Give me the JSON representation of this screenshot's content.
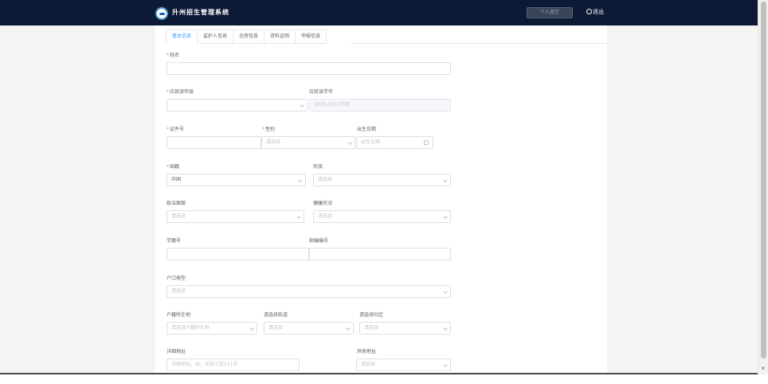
{
  "header": {
    "title": "升州招生管理系统",
    "profile_label": "个人真空",
    "logout_label": "退出"
  },
  "tabs": [
    "基本信息",
    "监护人信息",
    "住房信息",
    "资料证明",
    "申报信息"
  ],
  "form": {
    "name": {
      "label": "姓名",
      "value": ""
    },
    "grade": {
      "label": "应就读年级",
      "placeholder": ""
    },
    "school_year": {
      "label": "应就读学年",
      "value": "2020-2021学年"
    },
    "id_no": {
      "label": "证件号",
      "value": ""
    },
    "gender": {
      "label": "性别",
      "placeholder": "请选择"
    },
    "birth_date": {
      "label": "出生日期",
      "placeholder": "出生日期"
    },
    "nationality": {
      "label": "国籍",
      "value": "中国"
    },
    "ethnicity": {
      "label": "民族",
      "placeholder": "请选择"
    },
    "political": {
      "label": "政治面貌",
      "placeholder": "请选择"
    },
    "health": {
      "label": "健康状况",
      "placeholder": "请选择"
    },
    "student_no": {
      "label": "学籍号",
      "value": ""
    },
    "postal_code": {
      "label": "邮编编号",
      "value": ""
    },
    "hukou_type": {
      "label": "户口类型",
      "placeholder": "请选择"
    },
    "hukou_location": {
      "label": "户籍所在地",
      "placeholder": "请选择户籍所在地"
    },
    "street": {
      "label": "请选择街道",
      "placeholder": "请选择"
    },
    "community": {
      "label": "请选择社区",
      "placeholder": "请选择"
    },
    "address": {
      "label": "详细地址",
      "placeholder": "详细地址，如：天府三街111号"
    },
    "other_address": {
      "label": "其他地址",
      "placeholder": "请选择"
    }
  }
}
